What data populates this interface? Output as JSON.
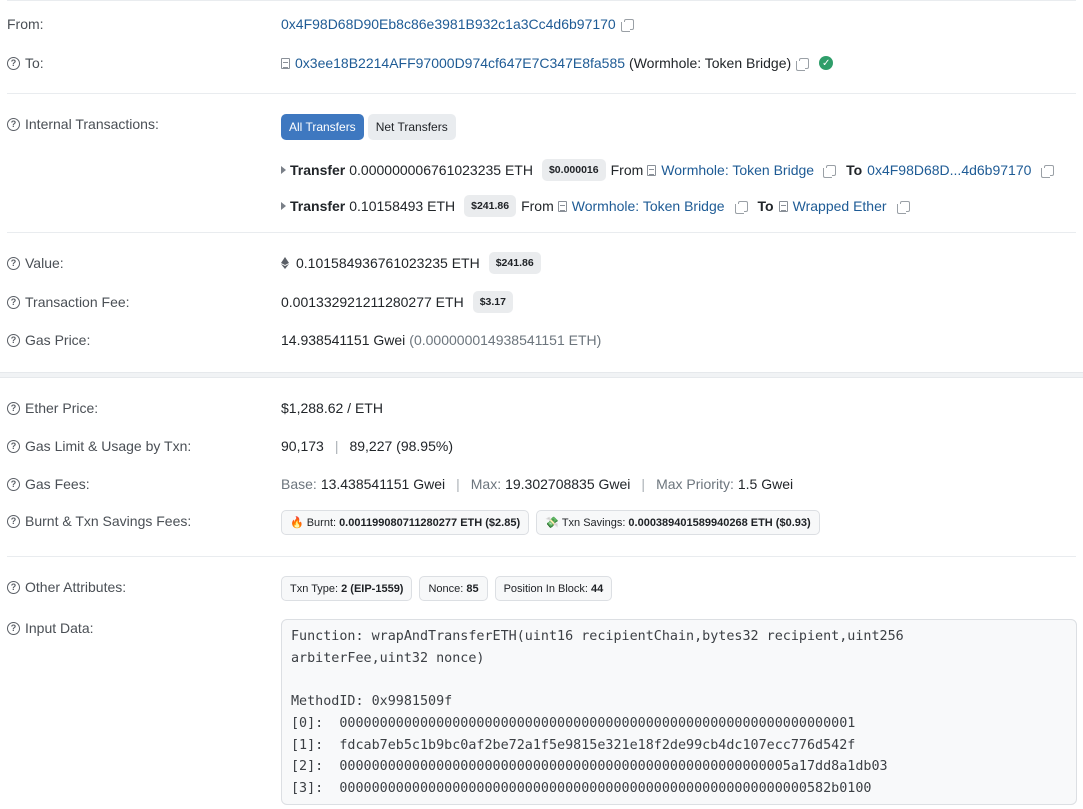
{
  "from": {
    "label": "From:",
    "address": "0x4F98D68D90Eb8c86e3981B932c1a3Cc4d6b97170"
  },
  "to": {
    "label": "To:",
    "address": "0x3ee18B2214AFF97000D974cf647E7C347E8fa585",
    "name": "(Wormhole: Token Bridge)"
  },
  "internal": {
    "label": "Internal Transactions:",
    "tabs": [
      "All Transfers",
      "Net Transfers"
    ],
    "transfers": [
      {
        "kw": "Transfer",
        "amount": "0.000000006761023235 ETH",
        "usd": "$0.000016",
        "from_kw": "From",
        "from": "Wormhole: Token Bridge",
        "to_kw": "To",
        "to": "0x4F98D68D...4d6b97170"
      },
      {
        "kw": "Transfer",
        "amount": "0.10158493 ETH",
        "usd": "$241.86",
        "from_kw": "From",
        "from": "Wormhole: Token Bridge",
        "to_kw": "To",
        "to": "Wrapped Ether"
      }
    ]
  },
  "value": {
    "label": "Value:",
    "amount": "0.101584936761023235 ETH",
    "usd": "$241.86"
  },
  "fee": {
    "label": "Transaction Fee:",
    "amount": "0.001332921211280277 ETH",
    "usd": "$3.17"
  },
  "gas_price": {
    "label": "Gas Price:",
    "gwei": "14.938541151 Gwei",
    "eth": "(0.000000014938541151 ETH)"
  },
  "ether_price": {
    "label": "Ether Price:",
    "value": "$1,288.62 / ETH"
  },
  "gas_limit": {
    "label": "Gas Limit & Usage by Txn:",
    "limit": "90,173",
    "usage": "89,227 (98.95%)"
  },
  "gas_fees": {
    "label": "Gas Fees:",
    "base_kw": "Base:",
    "base": "13.438541151 Gwei",
    "max_kw": "Max:",
    "max": "19.302708835 Gwei",
    "prio_kw": "Max Priority:",
    "prio": "1.5 Gwei"
  },
  "burnt": {
    "label": "Burnt & Txn Savings Fees:",
    "burnt_kw": "Burnt:",
    "burnt": "0.001199080711280277 ETH ($2.85)",
    "savings_kw": "Txn Savings:",
    "savings": "0.000389401589940268 ETH ($0.93)"
  },
  "attrs": {
    "label": "Other Attributes:",
    "type_kw": "Txn Type:",
    "type": "2 (EIP-1559)",
    "nonce_kw": "Nonce:",
    "nonce": "85",
    "pos_kw": "Position In Block:",
    "pos": "44"
  },
  "input": {
    "label": "Input Data:",
    "text": "Function: wrapAndTransferETH(uint16 recipientChain,bytes32 recipient,uint256\narbiterFee,uint32 nonce)\n\nMethodID: 0x9981509f\n[0]:  0000000000000000000000000000000000000000000000000000000000000001\n[1]:  fdcab7eb5c1b9bc0af2be72a1f5e9815e321e18f2de99cb4dc107ecc776d542f\n[2]:  00000000000000000000000000000000000000000000000000000005a17dd8a1db03\n[3]:  0000000000000000000000000000000000000000000000000000000000582b0100"
  },
  "colors": {
    "link": "#1e5b95",
    "accent": "#3e78c0",
    "verified": "#2f9e6a"
  }
}
